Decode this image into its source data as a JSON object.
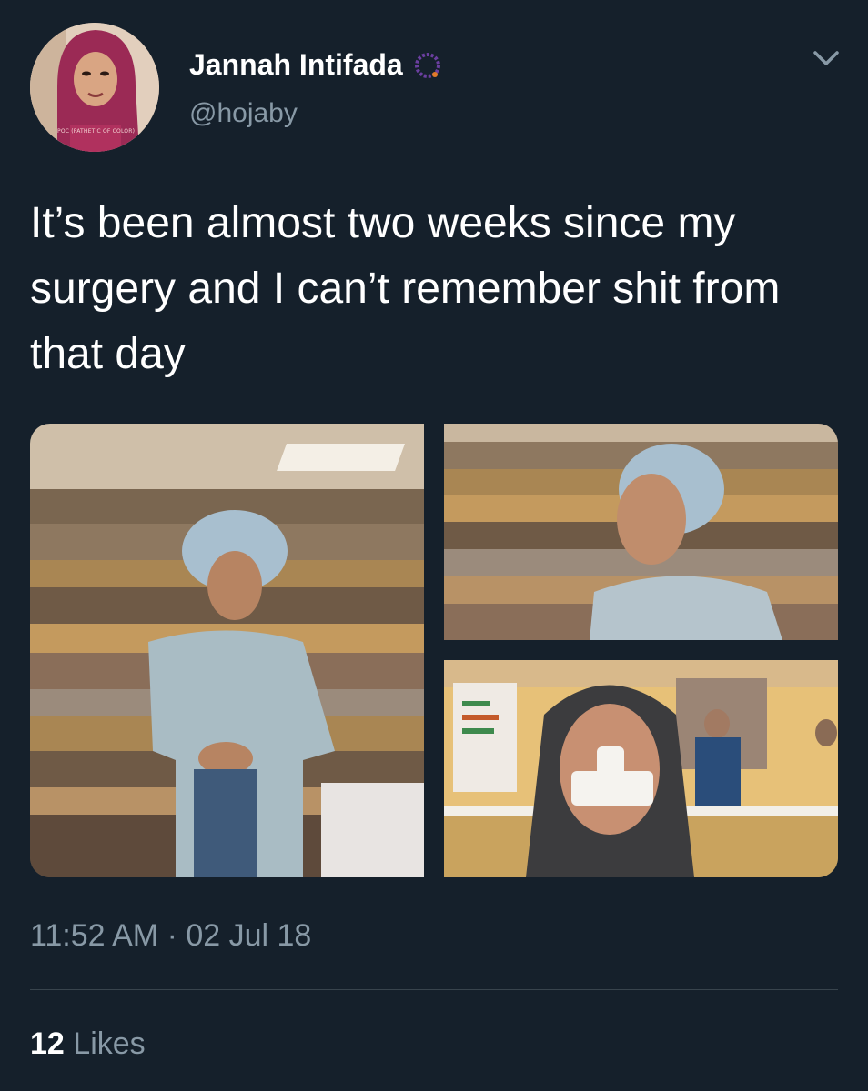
{
  "tweet": {
    "author": {
      "display_name": "Jannah Intifada",
      "handle": "@hojaby",
      "avatar_caption": "POC (PATHETIC OF COLOR)",
      "badge_icon": "beaded-circle-icon"
    },
    "menu_icon": "chevron-down-icon",
    "text": "It’s been almost two weeks since my surgery and I can’t remember shit from that day",
    "timestamp": "11:52 AM · 02 Jul 18",
    "likes": {
      "count": "12",
      "label": "Likes"
    },
    "media": [
      {
        "kind": "photo",
        "subject": "woman in hospital gown and surgical cap standing before curtain"
      },
      {
        "kind": "photo",
        "subject": "selfie in surgical cap before striped curtain"
      },
      {
        "kind": "photo",
        "subject": "selfie in hoodie with nose bandage in hospital room"
      }
    ]
  },
  "colors": {
    "background": "#15202b",
    "text_primary": "#ffffff",
    "text_secondary": "#8899a6",
    "divider": "#38444d",
    "badge_purple": "#6b3fa0"
  }
}
